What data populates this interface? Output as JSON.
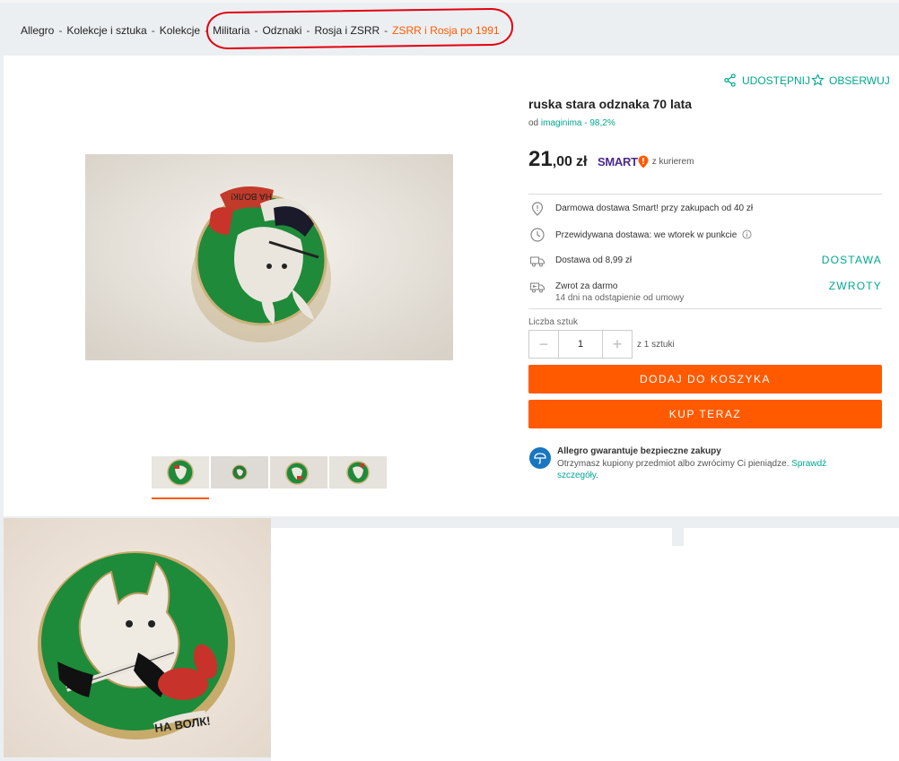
{
  "breadcrumb": {
    "items": [
      "Allegro",
      "Kolekcje i sztuka",
      "Kolekcje",
      "Militaria",
      "Odznaki",
      "Rosja i ZSRR"
    ],
    "current": "ZSRR i Rosja po 1991",
    "separator": "-"
  },
  "actions": {
    "share_label": "UDOSTĘPNIJ",
    "observe_label": "OBSERWUJ"
  },
  "product": {
    "title": "ruska stara odznaka 70 lata",
    "seller_prefix": "od",
    "seller_name": "imaginima",
    "seller_rating": "- 98,2%",
    "price_int": "21",
    "price_dec": ",00",
    "currency": "zł",
    "smart_label": "SMART",
    "courier_note": "z kurierem"
  },
  "delivery": {
    "free_smart": "Darmowa dostawa Smart! przy zakupach od 40 zł",
    "expected": "Przewidywana dostawa: we wtorek w punkcie",
    "cost": "Dostawa od 8,99 zł",
    "cost_link": "DOSTAWA",
    "return_title": "Zwrot za darmo",
    "return_sub": "14 dni na odstąpienie od umowy",
    "return_link": "ZWROTY"
  },
  "quantity": {
    "label": "Liczba sztuk",
    "value": "1",
    "minus": "−",
    "plus": "+",
    "of_total": "z 1 sztuki"
  },
  "buttons": {
    "add_to_cart": "DODAJ DO KOSZYKA",
    "buy_now": "KUP TERAZ"
  },
  "guarantee": {
    "title": "Allegro gwarantuje bezpieczne zakupy",
    "text": "Otrzymasz kupiony przedmiot albo zwrócimy Ci pieniądze.",
    "link": "Sprawdź szczegóły",
    "suffix": "."
  },
  "colors": {
    "accent_orange": "#ff5a00",
    "teal_link": "#00a790",
    "smart_purple": "#4a2a8a",
    "highlight_red": "#e3000f"
  },
  "gallery": {
    "thumbnail_count": 4,
    "active_index": 0
  }
}
